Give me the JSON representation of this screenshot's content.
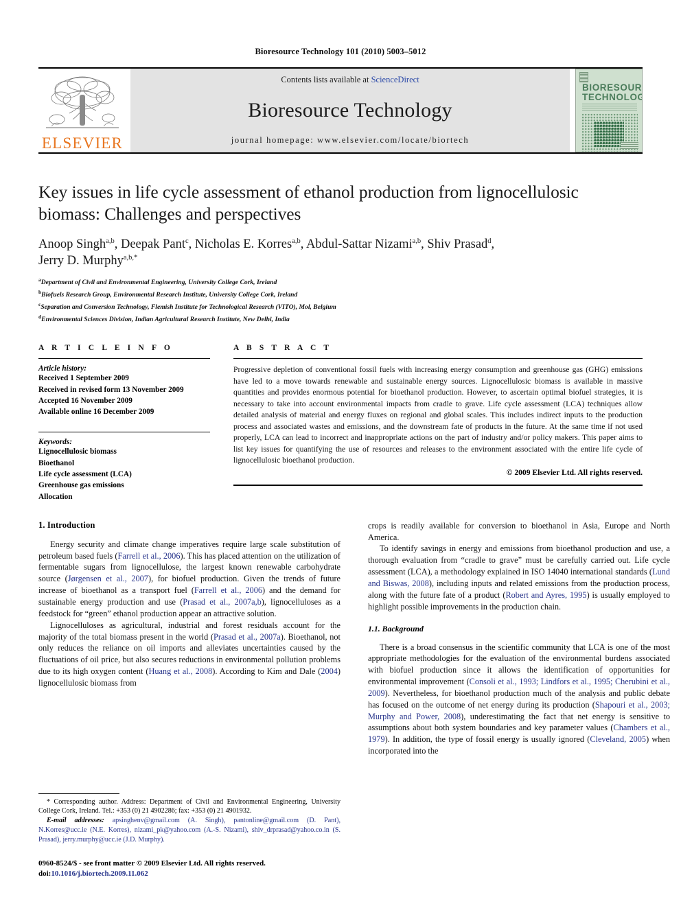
{
  "running_head": "Bioresource Technology 101 (2010) 5003–5012",
  "masthead": {
    "publisher_name": "ELSEVIER",
    "contents_line_prefix": "Contents lists available at ",
    "contents_line_link": "ScienceDirect",
    "journal_title": "Bioresource Technology",
    "homepage": "journal homepage: www.elsevier.com/locate/biortech",
    "cover_title_line1": "BIORESOURCE",
    "cover_title_line2": "TECHNOLOGY"
  },
  "article": {
    "title": "Key issues in life cycle assessment of ethanol production from lignocellulosic biomass: Challenges and perspectives",
    "authors_line1": "Anoop Singh a,b, Deepak Pant c, Nicholas E. Korres a,b, Abdul-Sattar Nizami a,b, Shiv Prasad d,",
    "authors_line2": "Jerry D. Murphy a,b,*",
    "affiliations": [
      "a Department of Civil and Environmental Engineering, University College Cork, Ireland",
      "b Biofuels Research Group, Environmental Research Institute, University College Cork, Ireland",
      "c Separation and Conversion Technology, Flemish Institute for Technological Research (VITO), Mol, Belgium",
      "d Environmental Sciences Division, Indian Agricultural Research Institute, New Delhi, India"
    ]
  },
  "article_info": {
    "heading": "A R T I C L E   I N F O",
    "history_label": "Article history:",
    "history": [
      "Received 1 September 2009",
      "Received in revised form 13 November 2009",
      "Accepted 16 November 2009",
      "Available online 16 December 2009"
    ],
    "keywords_label": "Keywords:",
    "keywords": [
      "Lignocellulosic biomass",
      "Bioethanol",
      "Life cycle assessment (LCA)",
      "Greenhouse gas emissions",
      "Allocation"
    ]
  },
  "abstract": {
    "heading": "A B S T R A C T",
    "text": "Progressive depletion of conventional fossil fuels with increasing energy consumption and greenhouse gas (GHG) emissions have led to a move towards renewable and sustainable energy sources. Lignocellulosic biomass is available in massive quantities and provides enormous potential for bioethanol production. However, to ascertain optimal biofuel strategies, it is necessary to take into account environmental impacts from cradle to grave. Life cycle assessment (LCA) techniques allow detailed analysis of material and energy fluxes on regional and global scales. This includes indirect inputs to the production process and associated wastes and emissions, and the downstream fate of products in the future. At the same time if not used properly, LCA can lead to incorrect and inappropriate actions on the part of industry and/or policy makers. This paper aims to list key issues for quantifying the use of resources and releases to the environment associated with the entire life cycle of lignocellulosic bioethanol production.",
    "copyright": "© 2009 Elsevier Ltd. All rights reserved."
  },
  "body": {
    "section1_heading": "1. Introduction",
    "subsection_heading": "1.1. Background",
    "left_paragraphs": [
      "Energy security and climate change imperatives require large scale substitution of petroleum based fuels (Farrell et al., 2006). This has placed attention on the utilization of fermentable sugars from lignocellulose, the largest known renewable carbohydrate source (Jørgensen et al., 2007), for biofuel production. Given the trends of future increase of bioethanol as a transport fuel (Farrell et al., 2006) and the demand for sustainable energy production and use (Prasad et al., 2007a,b), lignocelluloses as a feedstock for “green” ethanol production appear an attractive solution.",
      "Lignocelluloses as agricultural, industrial and forest residuals account for the majority of the total biomass present in the world (Prasad et al., 2007a). Bioethanol, not only reduces the reliance on oil imports and alleviates uncertainties caused by the fluctuations of oil price, but also secures reductions in environmental pollution problems due to its high oxygen content (Huang et al., 2008). According to Kim and Dale (2004) lignocellulosic biomass from"
    ],
    "right_paragraphs": [
      "crops is readily available for conversion to bioethanol in Asia, Europe and North America.",
      "To identify savings in energy and emissions from bioethanol production and use, a thorough evaluation from “cradle to grave” must be carefully carried out. Life cycle assessment (LCA), a methodology explained in ISO 14040 international standards (Lund and Biswas, 2008), including inputs and related emissions from the production process, along with the future fate of a product (Robert and Ayres, 1995) is usually employed to highlight possible improvements in the production chain.",
      "There is a broad consensus in the scientific community that LCA is one of the most appropriate methodologies for the evaluation of the environmental burdens associated with biofuel production since it allows the identification of opportunities for environmental improvement (Consoli et al., 1993; Lindfors et al., 1995; Cherubini et al., 2009). Nevertheless, for bioethanol production much of the analysis and public debate has focused on the outcome of net energy during its production (Shapouri et al., 2003; Murphy and Power, 2008), underestimating the fact that net energy is sensitive to assumptions about both system boundaries and key parameter values (Chambers et al., 1979). In addition, the type of fossil energy is usually ignored (Cleveland, 2005) when incorporated into the"
    ]
  },
  "footnotes": {
    "corresponding": "* Corresponding author. Address: Department of Civil and Environmental Engineering, University College Cork, Ireland. Tel.: +353 (0) 21 4902286; fax: +353 (0) 21 4901932.",
    "email_label": "E-mail addresses:",
    "emails": "apsinghenv@gmail.com (A. Singh), pantonline@gmail.com (D. Pant), N.Korres@ucc.ie (N.E. Korres), nizami_pk@yahoo.com (A.-S. Nizami), shiv_drprasad@yahoo.co.in (S. Prasad), jerry.murphy@ucc.ie (J.D. Murphy).",
    "issn_line": "0960-8524/$ - see front matter © 2009 Elsevier Ltd. All rights reserved.",
    "doi_prefix": "doi:",
    "doi": "10.1016/j.biortech.2009.11.062"
  },
  "colors": {
    "elsevier_orange": "#E87722",
    "citation_blue": "#27348b",
    "banner_gray": "#e3e3e3",
    "cover_green": "#cfe0cf"
  }
}
